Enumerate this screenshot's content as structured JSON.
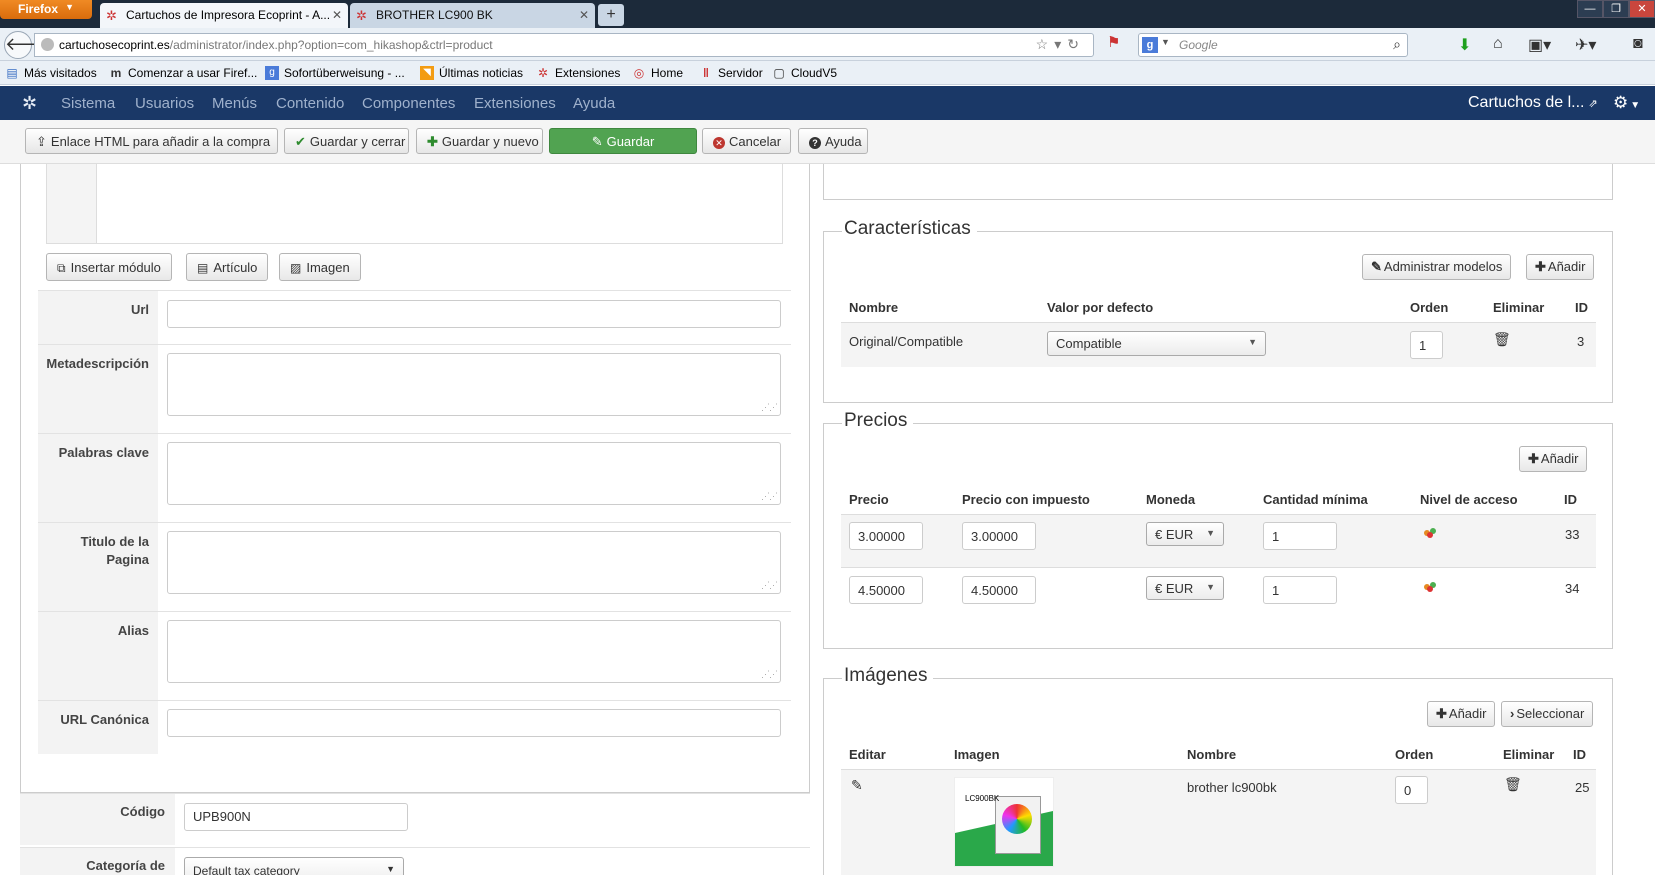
{
  "browser": {
    "app_button": "Firefox",
    "tabs": [
      {
        "title": "Cartuchos de Impresora Ecoprint - A..."
      },
      {
        "title": "BROTHER LC900 BK"
      }
    ],
    "url_host": "cartuchosecoprint.es",
    "url_path": "/administrator/index.php?option=com_hikashop&ctrl=product",
    "search_placeholder": "Google",
    "bookmarks": [
      "Más visitados",
      "Comenzar a usar Firef...",
      "Sofortüberweisung - ...",
      "Últimas noticias",
      "Extensiones",
      "Home",
      "Servidor",
      "CloudV5"
    ]
  },
  "admin": {
    "menu": [
      "Sistema",
      "Usuarios",
      "Menús",
      "Contenido",
      "Componentes",
      "Extensiones",
      "Ayuda"
    ],
    "site_name": "Cartuchos de l..."
  },
  "toolbar": {
    "html_link": "Enlace HTML para añadir a la compra",
    "save_close": "Guardar y cerrar",
    "save_new": "Guardar y nuevo",
    "save": "Guardar",
    "cancel": "Cancelar",
    "help": "Ayuda"
  },
  "editor_buttons": {
    "insert_module": "Insertar módulo",
    "article": "Artículo",
    "image": "Imagen"
  },
  "seo_fields": {
    "url": "Url",
    "meta_description": "Metadescripción",
    "keywords": "Palabras clave",
    "page_title_1": "Titulo de la",
    "page_title_2": "Pagina",
    "alias": "Alias",
    "canonical_url": "URL Canónica"
  },
  "product": {
    "code_label": "Código",
    "code_value": "UPB900N",
    "tax_category_label": "Categoría de",
    "tax_category_value": "Default tax category"
  },
  "characteristics": {
    "legend": "Características",
    "manage_models": "Administrar modelos",
    "add": "Añadir",
    "headers": {
      "name": "Nombre",
      "default_value": "Valor por defecto",
      "order": "Orden",
      "delete": "Eliminar",
      "id": "ID"
    },
    "row": {
      "name": "Original/Compatible",
      "default_value": "Compatible",
      "order": "1",
      "id": "3"
    }
  },
  "prices": {
    "legend": "Precios",
    "add": "Añadir",
    "headers": {
      "price": "Precio",
      "price_tax": "Precio con impuesto",
      "currency": "Moneda",
      "min_qty": "Cantidad mínima",
      "access": "Nivel de acceso",
      "id": "ID"
    },
    "rows": [
      {
        "price": "3.00000",
        "price_tax": "3.00000",
        "currency": "€ EUR",
        "min_qty": "1",
        "id": "33"
      },
      {
        "price": "4.50000",
        "price_tax": "4.50000",
        "currency": "€ EUR",
        "min_qty": "1",
        "id": "34"
      }
    ]
  },
  "images": {
    "legend": "Imágenes",
    "add": "Añadir",
    "select": "Seleccionar",
    "headers": {
      "edit": "Editar",
      "image": "Imagen",
      "name": "Nombre",
      "order": "Orden",
      "delete": "Eliminar",
      "id": "ID"
    },
    "row": {
      "name": "brother lc900bk",
      "order": "0",
      "id": "25",
      "thumb_label": "LC900BK"
    }
  }
}
